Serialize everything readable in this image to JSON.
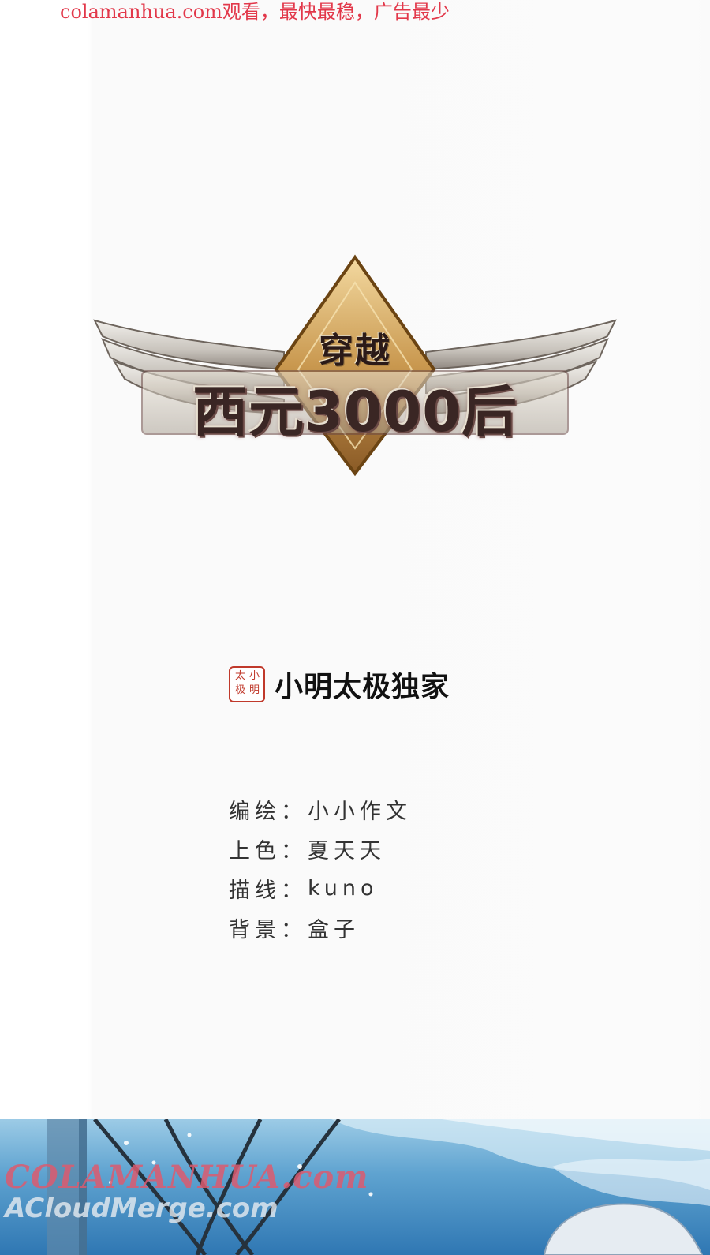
{
  "top_banner": {
    "text": "colamanhua.com观看，最快最稳，广告最少",
    "color": "#e2384a"
  },
  "logo": {
    "title_top": "穿越",
    "title_main": "西元3000后",
    "icon": "winged-crest-logo"
  },
  "publisher": {
    "seal_chars": [
      "小",
      "明",
      "太",
      "极"
    ],
    "seal_icon": "red-seal-stamp",
    "name": "小明太极独家"
  },
  "credits": [
    {
      "label": "编绘：",
      "value": "小小作文"
    },
    {
      "label": "上色：",
      "value": "夏天天"
    },
    {
      "label": "描线：",
      "value": "kuno"
    },
    {
      "label": "背景：",
      "value": "盒子"
    }
  ],
  "watermark": {
    "line1": "COLAMANHUA.com",
    "line2": "ACloudMerge.com"
  },
  "colors": {
    "banner_red": "#e2384a",
    "seal_red": "#c0392b",
    "sky_blue": "#5fa3d0"
  }
}
